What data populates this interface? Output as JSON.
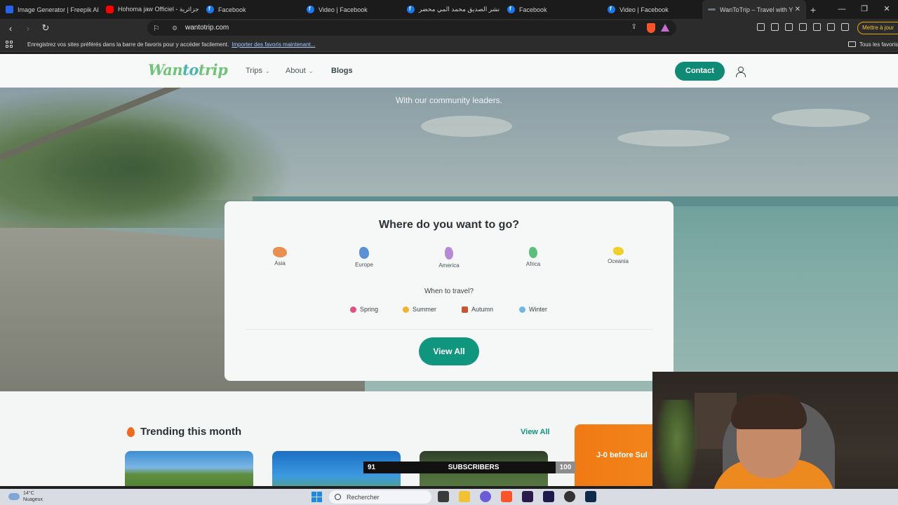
{
  "tabs": [
    {
      "title": "Image Generator | Freepik AI",
      "icon": "freepik-icon"
    },
    {
      "title": "Hohoma jaw Officiel - جزائرية",
      "icon": "youtube-icon"
    },
    {
      "title": "Facebook",
      "icon": "facebook-icon"
    },
    {
      "title": "Video | Facebook",
      "icon": "facebook-icon"
    },
    {
      "title": "نشر الصديق محمد المي محضر",
      "icon": "facebook-icon"
    },
    {
      "title": "Facebook",
      "icon": "facebook-icon"
    },
    {
      "title": "Video | Facebook",
      "icon": "facebook-icon"
    },
    {
      "title": "WanToTrip – Travel with Y",
      "icon": "wantotrip-icon",
      "active": true
    }
  ],
  "address": {
    "url": "wantotrip.com"
  },
  "update_button": "Mettre à jour",
  "bookmarks_bar": {
    "prompt": "Enregistrez vos sites préférés dans la barre de favoris pour y accéder facilement.",
    "import_link": "Importer des favoris maintenant...",
    "all_favorites": "Tous les favoris"
  },
  "site": {
    "logo": {
      "part1": "Wan",
      "part2": "to",
      "part3": "trip"
    },
    "menu": {
      "trips": "Trips",
      "about": "About",
      "blogs": "Blogs"
    },
    "contact": "Contact",
    "hero_subtitle": "With our community leaders.",
    "search": {
      "title": "Where do you want to go?",
      "regions": [
        {
          "label": "Asia",
          "color": "#e8904f"
        },
        {
          "label": "Europe",
          "color": "#5b8fd6"
        },
        {
          "label": "America",
          "color": "#b68ad9"
        },
        {
          "label": "Africa",
          "color": "#5cc07c"
        },
        {
          "label": "Oceania",
          "color": "#f2cf29"
        }
      ],
      "when": "When to travel?",
      "seasons": [
        {
          "label": "Spring",
          "icon": "flower-icon",
          "color": "#e2507f"
        },
        {
          "label": "Summer",
          "icon": "sun-icon",
          "color": "#f2b22a"
        },
        {
          "label": "Autumn",
          "icon": "leaf-icon",
          "color": "#c8562c"
        },
        {
          "label": "Winter",
          "icon": "snowflake-icon",
          "color": "#6fb7e8"
        }
      ],
      "view_all": "View All"
    },
    "trending": {
      "title": "Trending this month",
      "view_all": "View All",
      "promo": "J-0 before Sul"
    }
  },
  "subscribers": {
    "current": "91",
    "label": "SUBSCRIBERS",
    "goal": "100"
  },
  "taskbar": {
    "temp": "14°C",
    "weather": "Nuageux",
    "search_placeholder": "Rechercher"
  },
  "colors": {
    "accent": "#10957f",
    "contact": "#0e8a75",
    "logo_green": "#72c37a",
    "promo_orange": "#f07a14"
  }
}
